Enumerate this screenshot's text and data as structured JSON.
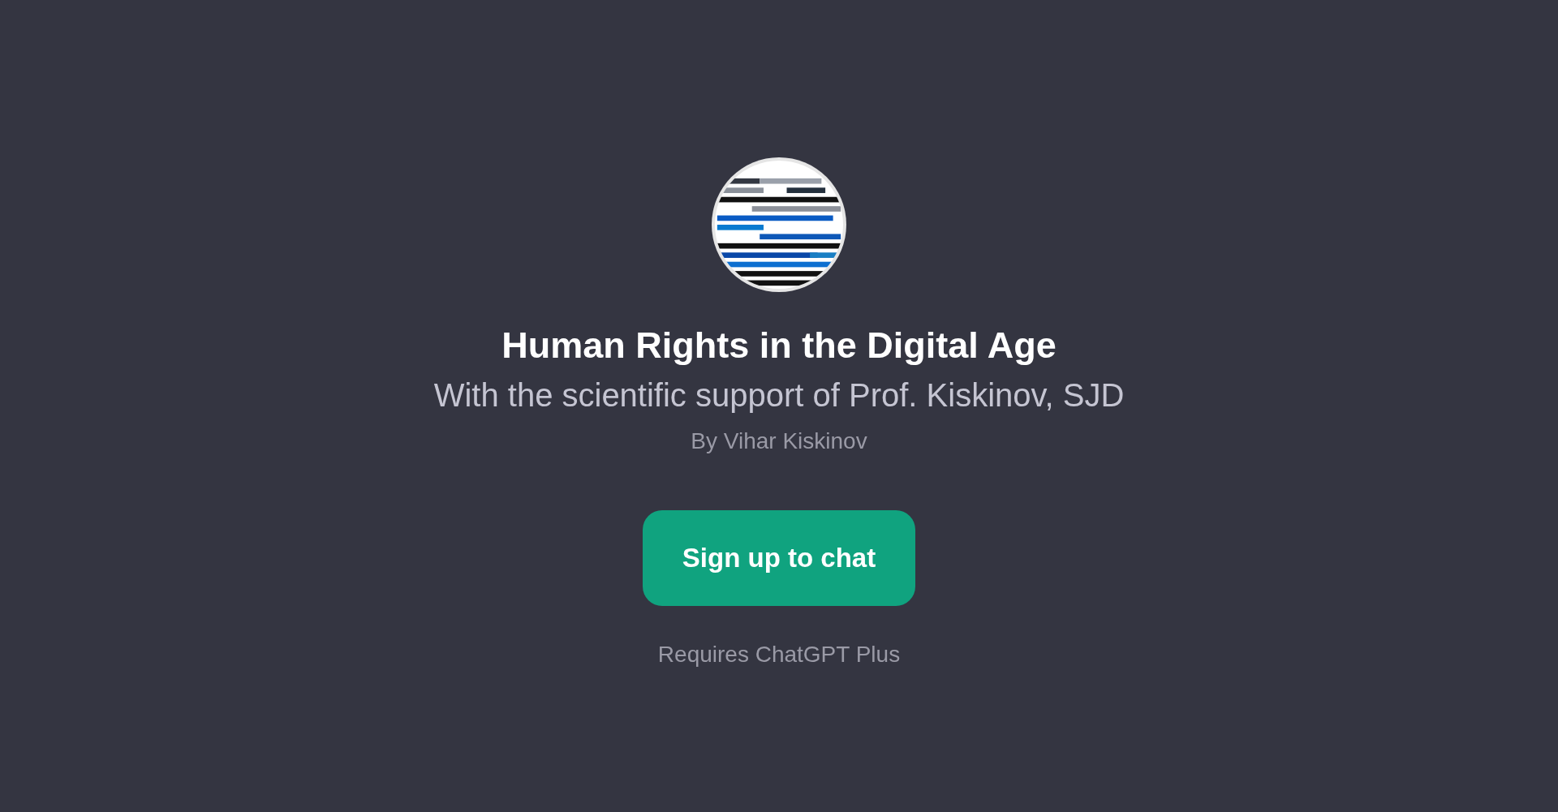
{
  "gpt": {
    "title": "Human Rights in the Digital Age",
    "subtitle": "With the scientific support of Prof. Kiskinov, SJD",
    "author": "By Vihar Kiskinov"
  },
  "signup_button": {
    "label": "Sign up to chat"
  },
  "note": "Requires ChatGPT Plus"
}
